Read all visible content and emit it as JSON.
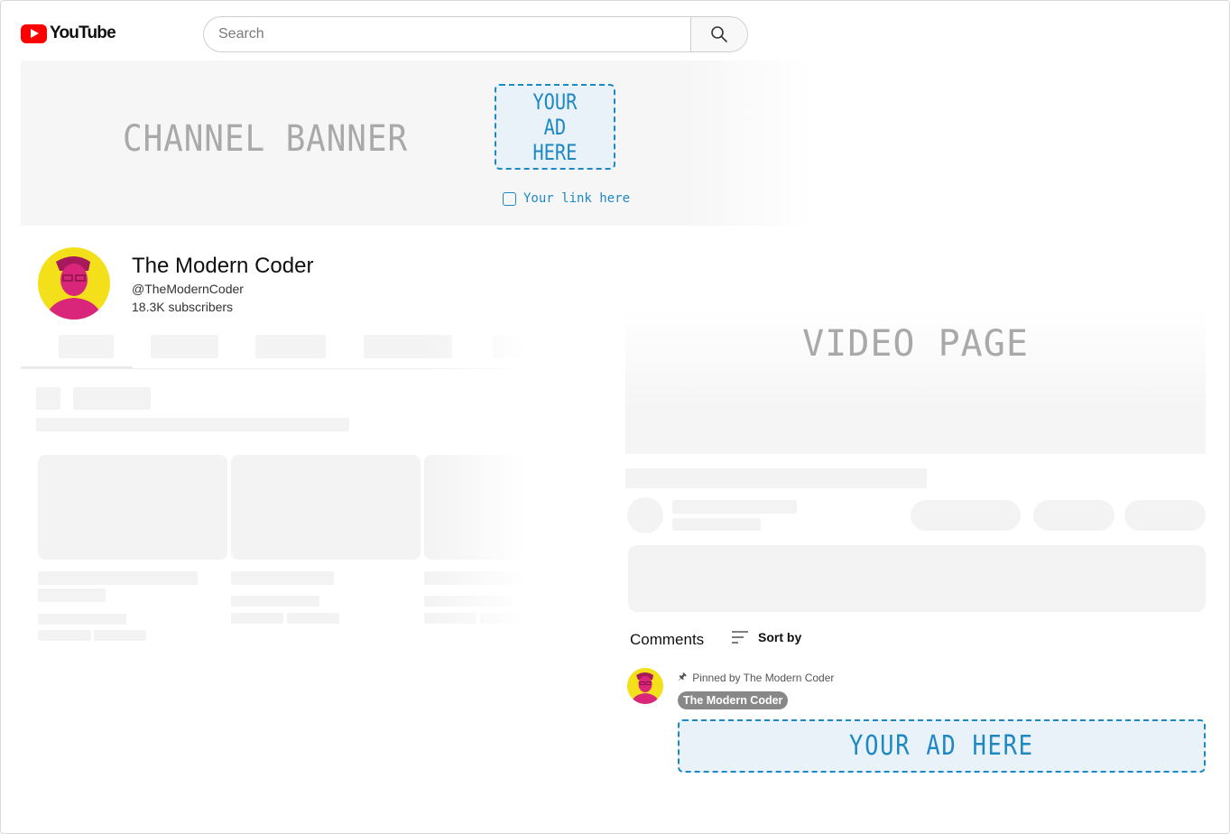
{
  "header": {
    "logo_text": "YouTube",
    "search_placeholder": "Search"
  },
  "banner": {
    "label": "CHANNEL BANNER",
    "ad_text": "YOUR\nAD\nHERE",
    "link_text": "Your link here"
  },
  "channel": {
    "name": "The Modern Coder",
    "handle": "@TheModernCoder",
    "subscribers": "18.3K subscribers"
  },
  "video_page": {
    "label": "VIDEO PAGE"
  },
  "comments": {
    "title": "Comments",
    "sort_label": "Sort by",
    "pinned_text": "Pinned by The Modern Coder",
    "author": "The Modern Coder",
    "ad_text": "YOUR AD HERE"
  },
  "colors": {
    "accent": "#1e88c2",
    "ad_background": "#eaf2f9",
    "avatar_background": "#f4e01a",
    "avatar_figure": "#d9267a",
    "logo_red": "#ff0000"
  }
}
